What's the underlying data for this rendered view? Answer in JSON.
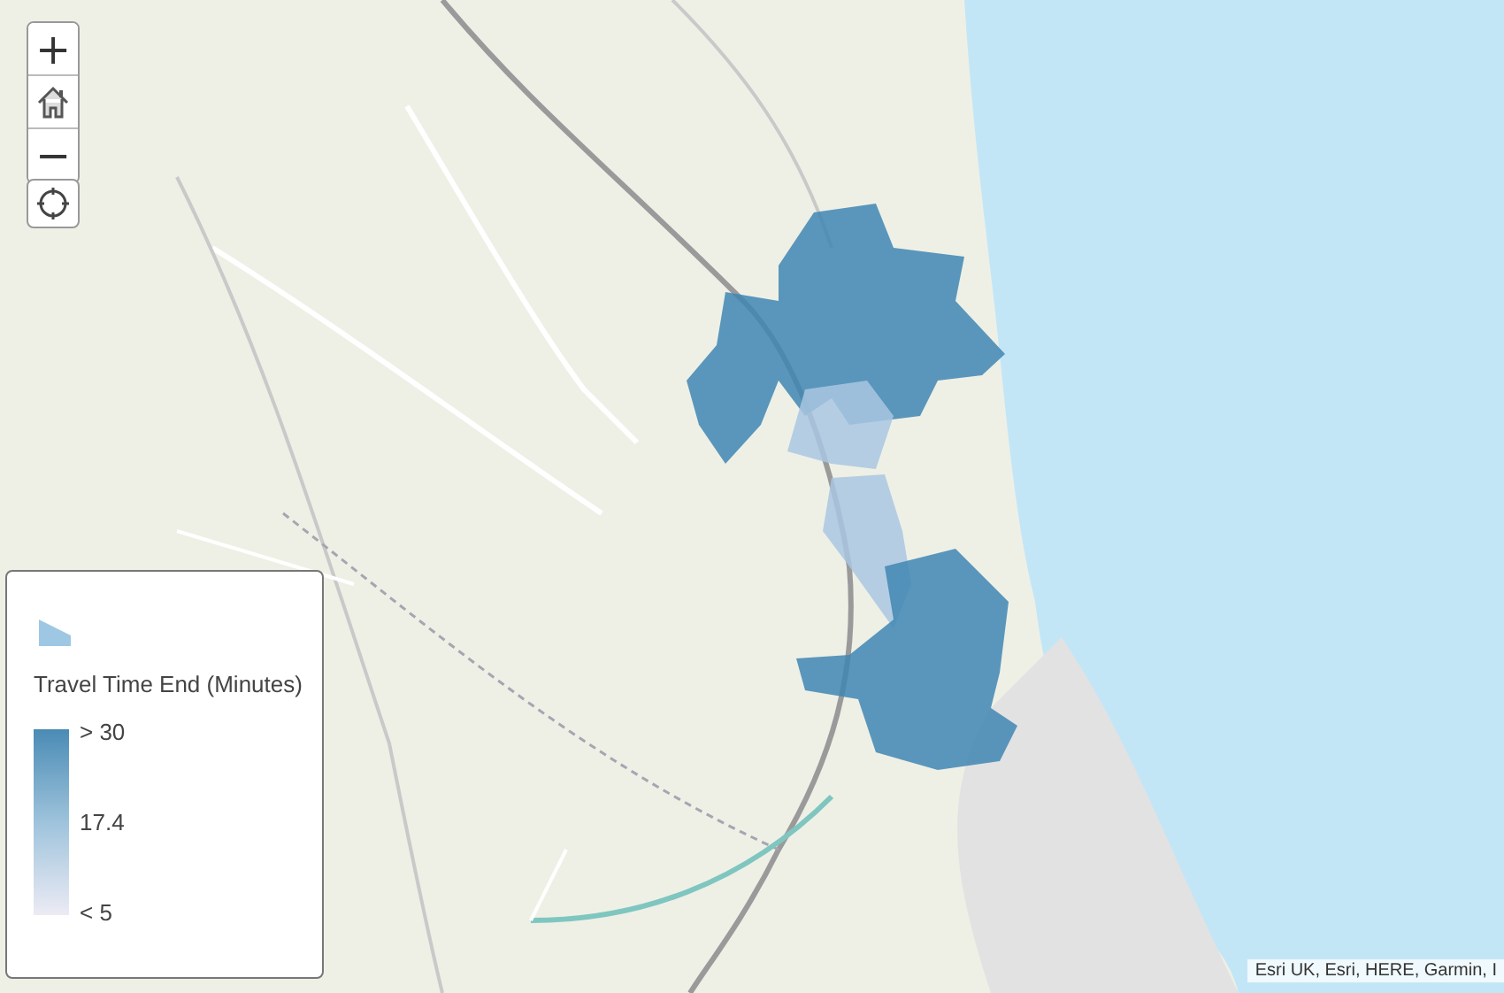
{
  "zoom_controls": [
    {
      "kind": "text",
      "label": "+"
    },
    {
      "kind": "home"
    },
    {
      "kind": "text",
      "label": "−"
    }
  ],
  "locate_control": {
    "kind": "locate"
  },
  "legend": {
    "title": "Travel Time End (Minutes)",
    "ramp_labels": [
      "> 30",
      "17.4",
      "< 5"
    ]
  },
  "attribution": "Esri UK, Esri, HERE, Garmin, I"
}
